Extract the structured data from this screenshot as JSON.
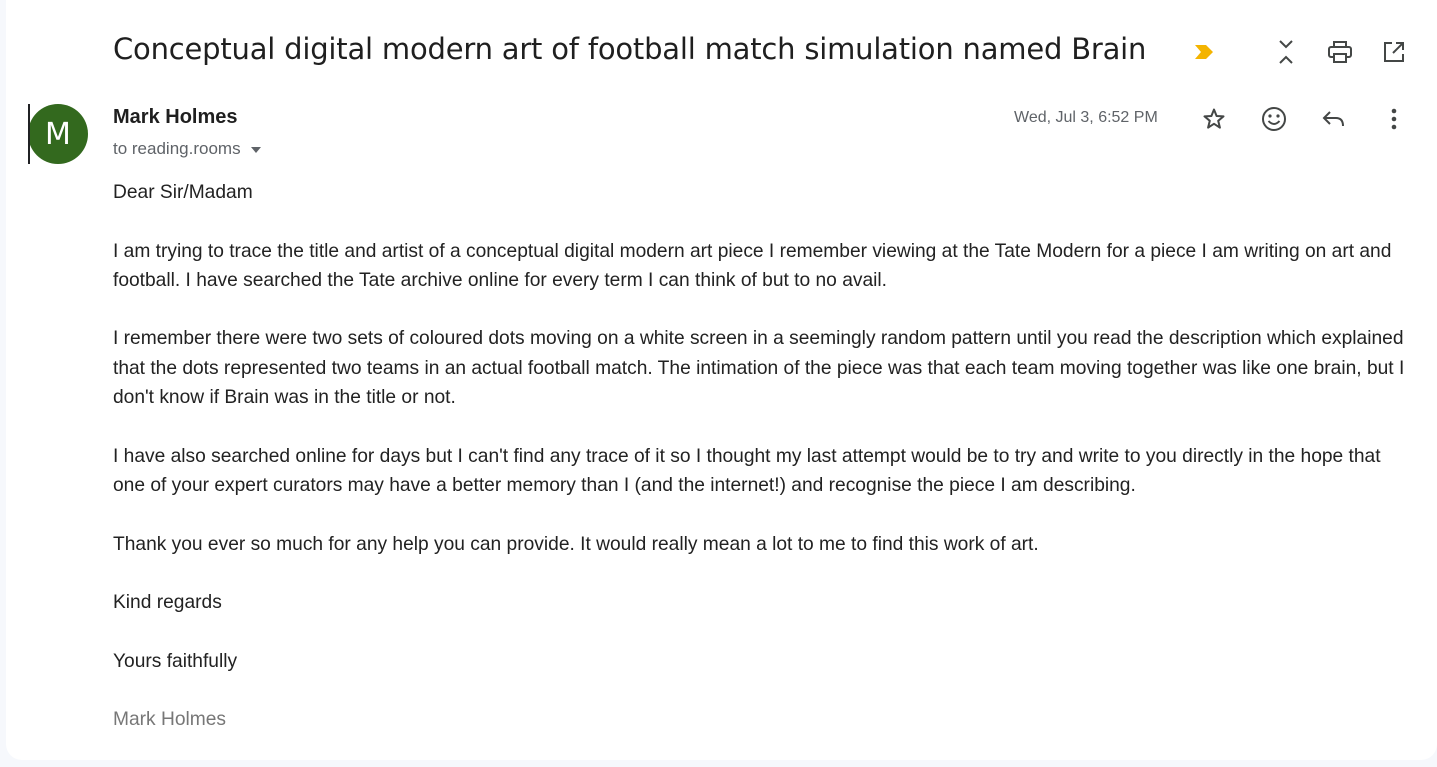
{
  "email": {
    "subject": "Conceptual digital modern art of football match simulation named Brain",
    "sender": {
      "name": "Mark Holmes",
      "initial": "M",
      "avatar_color": "#33691e"
    },
    "recipient_line": "to reading.rooms",
    "date": "Wed, Jul 3, 6:52 PM",
    "importance_color": "#f4b400",
    "header_actions": [
      {
        "icon": "collapse-icon"
      },
      {
        "icon": "print-icon"
      },
      {
        "icon": "open-in-new-window-icon"
      }
    ],
    "message_actions": [
      {
        "icon": "star-icon"
      },
      {
        "icon": "emoji-reaction-icon"
      },
      {
        "icon": "reply-icon"
      },
      {
        "icon": "more-vert-icon"
      }
    ],
    "body": {
      "greeting": "Dear Sir/Madam",
      "paragraphs": [
        "I am trying to trace the title and artist of a conceptual digital modern art piece I remember viewing at the Tate Modern for a piece I am writing on art and football. I have searched the Tate archive online for every term I can think of but to no avail.",
        "I remember there were two sets of coloured dots moving on a white screen in a seemingly random pattern until you read the description which explained that the dots represented two teams in an actual football match. The intimation of the piece was that each team moving together was like one brain, but I don't know if Brain was in the title or not.",
        "I have also searched online for days but I can't find any trace of it so I thought my last attempt would be to try and write to you directly in the hope that one of your expert curators may have a better memory than I (and the internet!) and recognise the piece I am describing.",
        "Thank you ever so much for any help you can provide. It would really mean a lot to me to find this work of art."
      ],
      "closing_1": "Kind regards",
      "closing_2": "Yours faithfully",
      "signature": "Mark Holmes"
    }
  }
}
